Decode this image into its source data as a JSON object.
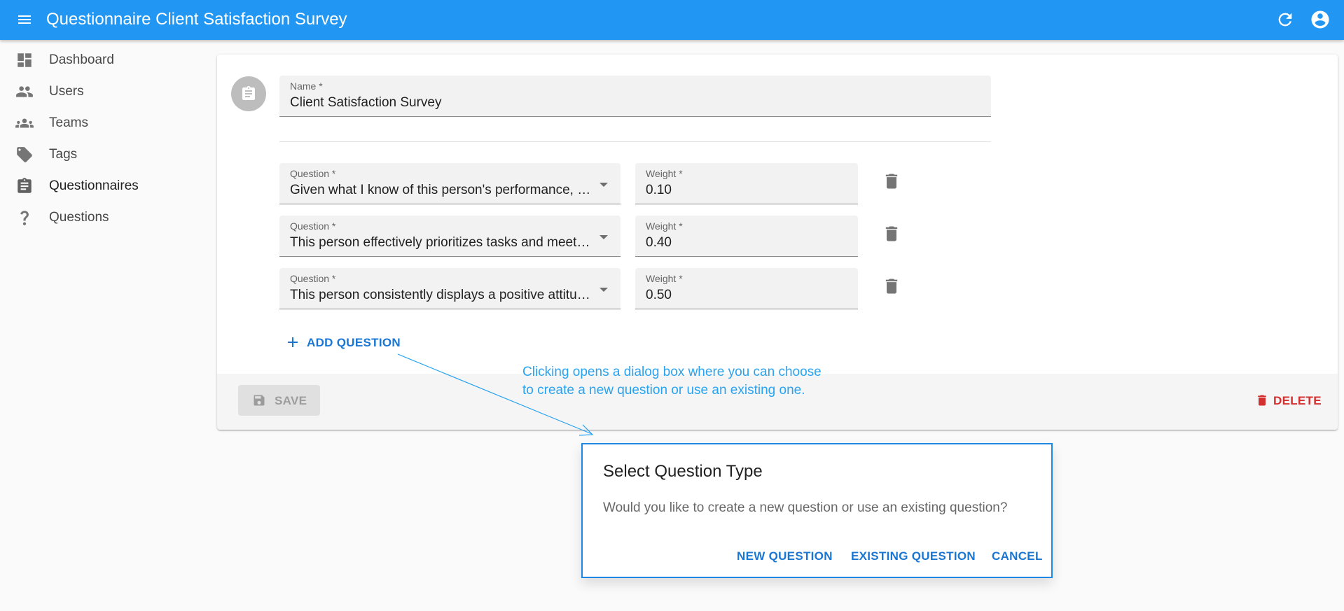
{
  "app_bar": {
    "title": "Questionnaire Client Satisfaction Survey",
    "menu_icon": "menu-icon",
    "refresh_icon": "refresh-icon",
    "account_icon": "account-circle-icon",
    "background": "#2196f3"
  },
  "sidebar": {
    "items": [
      {
        "label": "Dashboard",
        "icon": "dashboard-icon"
      },
      {
        "label": "Users",
        "icon": "people-icon"
      },
      {
        "label": "Teams",
        "icon": "groups-icon"
      },
      {
        "label": "Tags",
        "icon": "tag-icon"
      },
      {
        "label": "Questionnaires",
        "icon": "assignment-icon",
        "active": true
      },
      {
        "label": "Questions",
        "icon": "question-mark-icon"
      }
    ]
  },
  "form": {
    "avatar_icon": "assignment-icon",
    "name_field": {
      "label": "Name *",
      "value": "Client Satisfaction Survey"
    },
    "questions": [
      {
        "question_label": "Question *",
        "question_value": "Given what I know of this person's performance, and if it were my money, I would award this person the highest possible compensation increase and bonus.",
        "weight_label": "Weight *",
        "weight_value": "0.10"
      },
      {
        "question_label": "Question *",
        "question_value": "This person effectively prioritizes tasks and meets deadlines.",
        "weight_label": "Weight *",
        "weight_value": "0.40"
      },
      {
        "question_label": "Question *",
        "question_value": "This person consistently displays a positive attitude.",
        "weight_label": "Weight *",
        "weight_value": "0.50"
      }
    ],
    "add_question_label": "ADD QUESTION",
    "save_label": "SAVE",
    "delete_label": "DELETE"
  },
  "callout": {
    "line1": "Clicking opens a dialog box where you can choose",
    "line2": "to create a new question or use an existing one.",
    "color": "#29a3f0"
  },
  "dialog": {
    "title": "Select Question Type",
    "text": "Would you like to create a new question or use an existing question?",
    "new_label": "NEW QUESTION",
    "existing_label": "EXISTING QUESTION",
    "cancel_label": "CANCEL"
  }
}
